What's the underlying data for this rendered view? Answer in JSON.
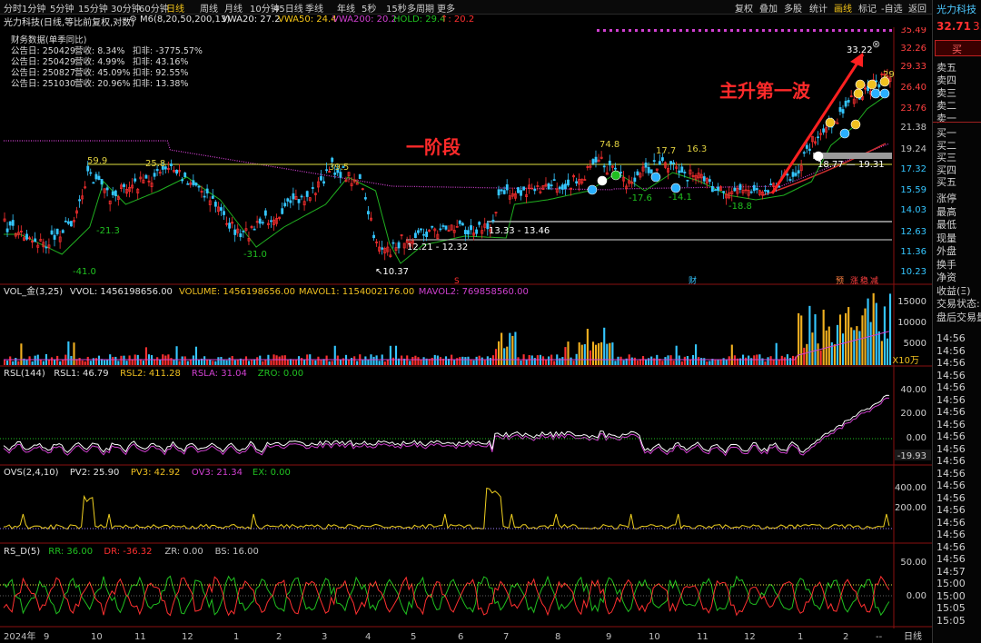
{
  "toolbar": {
    "periods": [
      "分时",
      "1分钟",
      "5分钟",
      "15分钟",
      "30分钟",
      "60分钟",
      "日线",
      "周线",
      "月线",
      "10分钟",
      "45日线",
      "季线",
      "年线",
      "5秒",
      "15秒",
      "多周期",
      "更多"
    ],
    "active_period": "日线",
    "right_tools": [
      "复权",
      "叠加",
      "多股",
      "统计",
      "画线",
      "标记",
      "-自选",
      "返回"
    ]
  },
  "title": {
    "stock": "光力科技(日线,等比前复权,对数)",
    "ma_label": "M6(8,20,50,200,13)",
    "vwa20": "VWA20: 27.2",
    "vwa50": "VWA50: 24.4",
    "vwa200": "VWA200: 20.2",
    "hold": "HOLD: 29.4",
    "arrow": "↑: 20.2"
  },
  "financial": {
    "header": "财务数据(单季同比)",
    "rows": [
      {
        "date": "公告日: 250429",
        "rev": "营收:  8.34%",
        "nx": "扣非:  -3775.57%"
      },
      {
        "date": "公告日: 250429",
        "rev": "营收:  4.99%",
        "nx": "扣非:  43.16%"
      },
      {
        "date": "公告日: 250827",
        "rev": "营收:  45.09%",
        "nx": "扣非:  92.55%"
      },
      {
        "date": "公告日: 251030",
        "rev": "营收:  20.96%",
        "nx": "扣非:  13.38%"
      }
    ]
  },
  "annotations": {
    "phase1": "一阶段",
    "phase2": "主升第一波",
    "peak": "33.22",
    "last_mark": "29",
    "range1": "12.21 - 12.32",
    "range2": "13.33 - 13.46",
    "range3": "18.77 — 19.31",
    "low": "10.37",
    "vals": [
      "59.9",
      "-21.3",
      "25.8",
      "-41.0",
      "-31.0",
      "39.5",
      "74.8",
      "17.7",
      "16.3",
      "-17.6",
      "-14.1",
      "-18.8"
    ],
    "markers": [
      "S",
      "财",
      "预",
      "涨",
      "稳",
      "减"
    ]
  },
  "price_axis": [
    "35.49",
    "32.26",
    "29.33",
    "26.40",
    "23.76",
    "21.38",
    "19.24",
    "17.32",
    "15.59",
    "14.03",
    "12.63",
    "11.36",
    "10.23"
  ],
  "vol_panel": {
    "header": [
      "VOL_金(3,25)",
      "VVOL: 1456198656.00",
      "VOLUME: 1456198656.00",
      "MAVOL1: 1154002176.00",
      "MAVOL2: 769858560.00"
    ],
    "axis": [
      "15000",
      "10000",
      "5000"
    ],
    "unit": "X10万"
  },
  "rsl_panel": {
    "header": [
      "RSL(144)",
      "RSL1: 46.79",
      "RSL2: 411.28",
      "RSLA: 31.04",
      "ZRO: 0.00"
    ],
    "axis": [
      "40.00",
      "20.00",
      "0.00"
    ],
    "last": "-19.93"
  },
  "ovs_panel": {
    "header": [
      "OVS(2,4,10)",
      "PV2: 25.90",
      "PV3: 42.92",
      "OV3: 21.34",
      "EX: 0.00"
    ],
    "axis": [
      "400.00",
      "200.00"
    ]
  },
  "rsd_panel": {
    "header": [
      "RS_D(5)",
      "RR: 36.00",
      "DR: -36.32",
      "ZR: 0.00",
      "BS: 16.00"
    ],
    "axis": [
      "50.00",
      "0.00"
    ]
  },
  "x_axis": {
    "labels": [
      "2024年",
      "9",
      "10",
      "11",
      "12",
      "1",
      "2",
      "3",
      "4",
      "5",
      "6",
      "7",
      "8",
      "9",
      "10",
      "11",
      "12",
      "1",
      "2",
      "--"
    ],
    "period": "日线"
  },
  "right_panel": {
    "name": "光力科技",
    "price": "32.71",
    "price_tail": "3.",
    "buy": "买",
    "sell": [
      "卖五",
      "卖四",
      "卖三",
      "卖二",
      "卖一"
    ],
    "bid": [
      "买一",
      "买二",
      "买三",
      "买四",
      "买五"
    ],
    "stats": [
      "涨停",
      "最高",
      "最低",
      "现量",
      "外盘",
      "换手",
      "净资",
      "收益(Ξ)",
      "交易状态:",
      "盘后交易量"
    ],
    "ticks": [
      "14:56",
      "14:56",
      "14:56",
      "14:56",
      "14:56",
      "14:56",
      "14:56",
      "14:56",
      "14:56",
      "14:56",
      "14:56",
      "14:56",
      "14:56",
      "14:56",
      "14:56",
      "14:56",
      "14:56",
      "14:56",
      "14:56",
      "14:57",
      "15:00",
      "15:00",
      "15:05",
      "15:05"
    ]
  },
  "colors": {
    "up": "#ff3030",
    "down": "#34c6ff",
    "yellow": "#f0e040",
    "magenta": "#d040d0",
    "green": "#20c020",
    "white": "#ffffff"
  }
}
